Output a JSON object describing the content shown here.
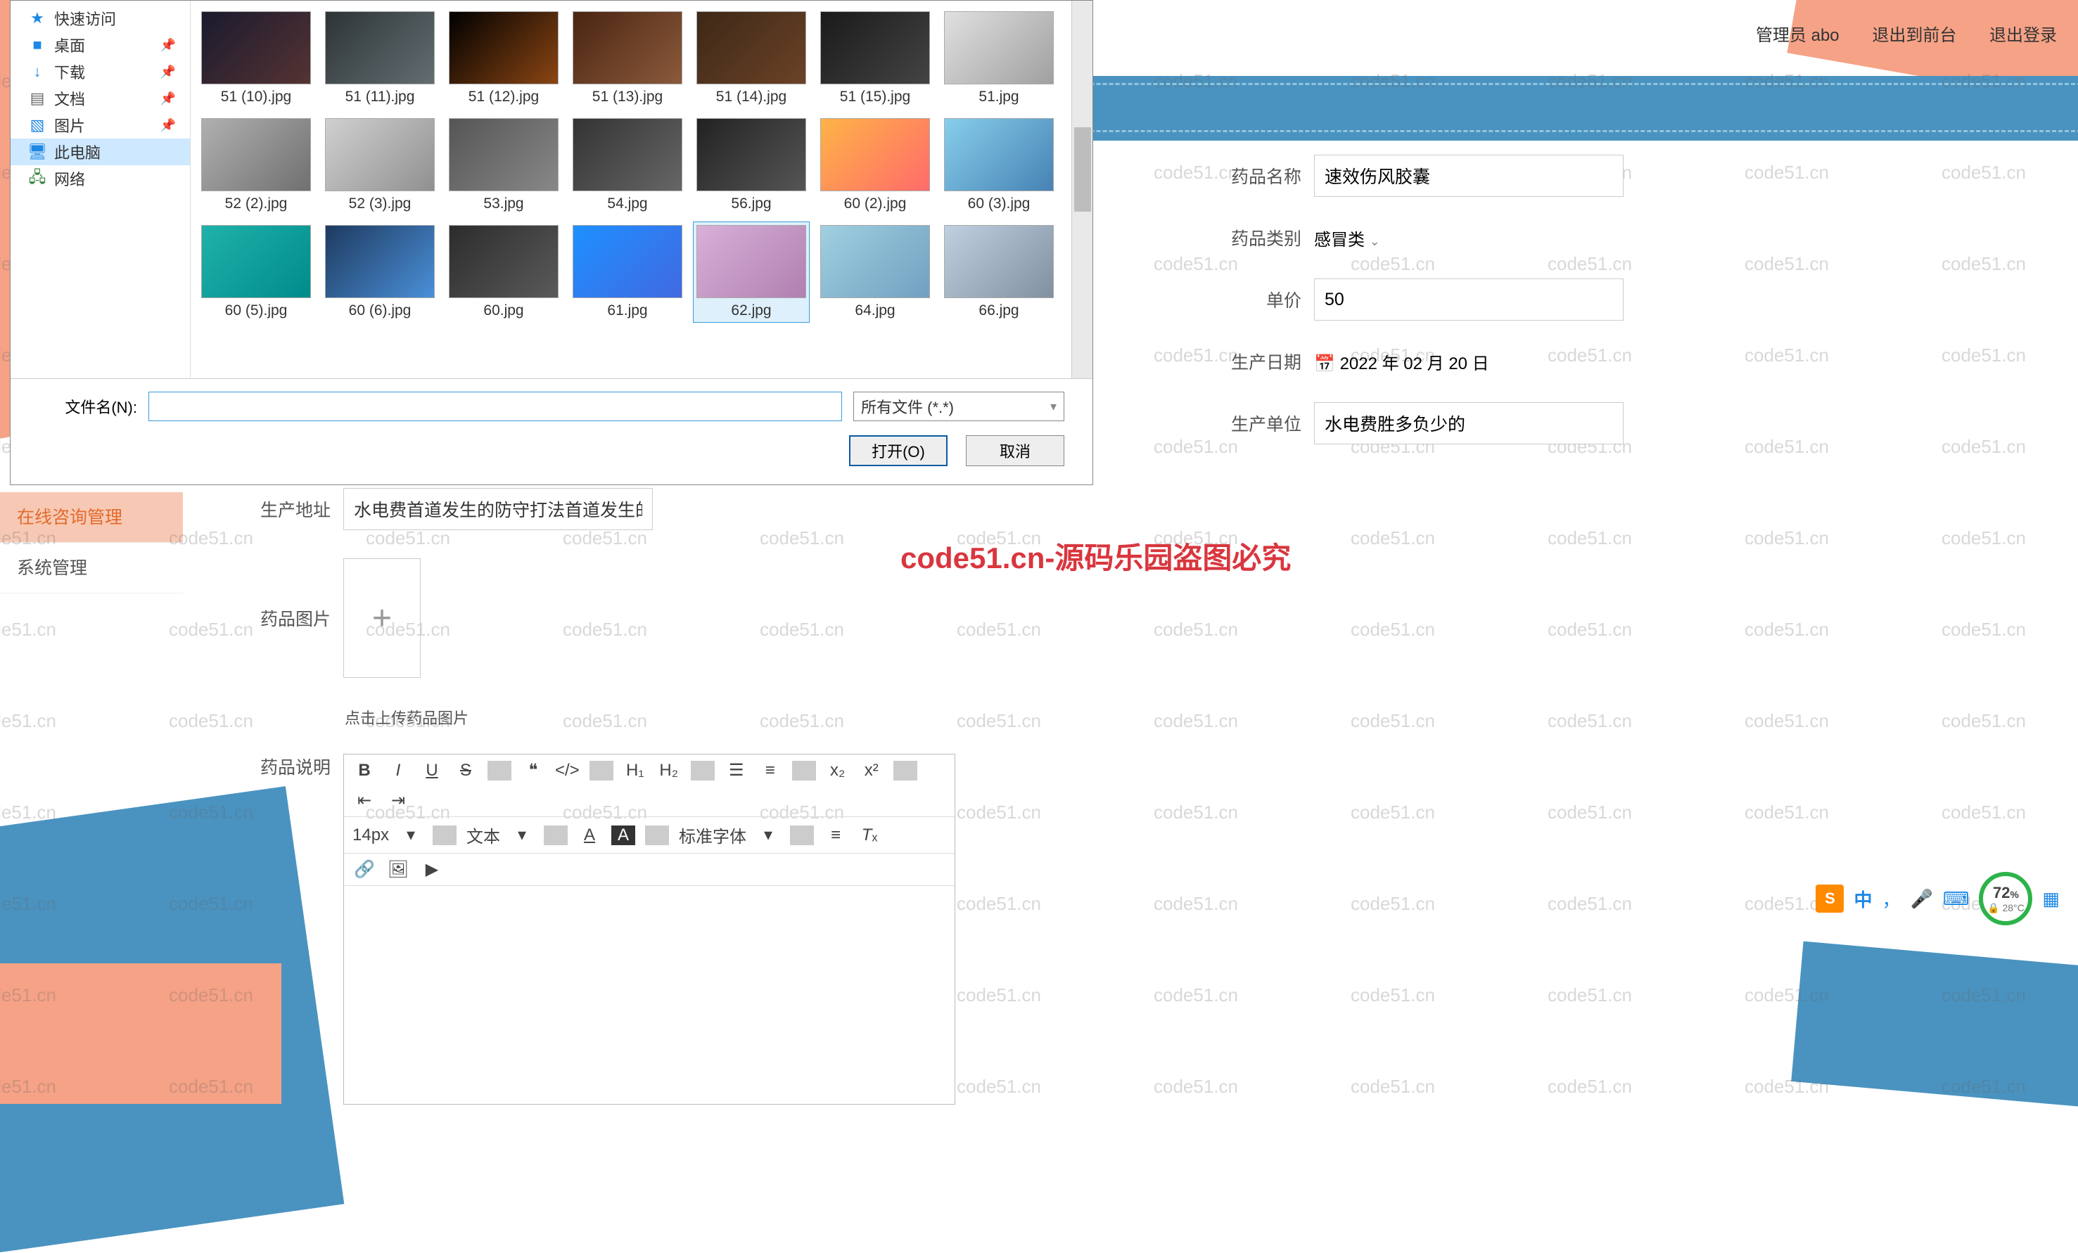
{
  "header": {
    "admin_label": "管理员 abo",
    "exit_front": "退出到前台",
    "logout": "退出登录"
  },
  "watermark": {
    "text": "code51.cn",
    "main": "code51.cn-源码乐园盗图必究"
  },
  "left_menu": {
    "items": [
      {
        "label": "在线咨询管理",
        "active": true
      },
      {
        "label": "系统管理",
        "active": false
      }
    ]
  },
  "form": {
    "address_label": "生产地址",
    "address_value": "水电费首道发生的防守打法首道发生的",
    "image_label": "药品图片",
    "upload_hint": "点击上传药品图片",
    "desc_label": "药品说明",
    "name_label": "药品名称",
    "name_value": "速效伤风胶囊",
    "category_label": "药品类别",
    "category_value": "感冒类",
    "price_label": "单价",
    "price_value": "50",
    "date_label": "生产日期",
    "date_value": "2022 年 02 月 20 日",
    "unit_label": "生产单位",
    "unit_value": "水电费胜多负少的"
  },
  "editor": {
    "font_size": "14px",
    "font_style_label": "文本",
    "font_family_label": "标准字体"
  },
  "file_dialog": {
    "nav": [
      {
        "icon": "star-icon",
        "label": "快速访问",
        "color": "#1e88e5"
      },
      {
        "icon": "desktop-icon",
        "label": "桌面",
        "color": "#1e88e5",
        "pin": true
      },
      {
        "icon": "download-icon",
        "label": "下载",
        "color": "#1e88e5",
        "pin": true
      },
      {
        "icon": "document-icon",
        "label": "文档",
        "color": "#666",
        "pin": true
      },
      {
        "icon": "picture-icon",
        "label": "图片",
        "color": "#1e88e5",
        "pin": true
      },
      {
        "icon": "pc-icon",
        "label": "此电脑",
        "color": "#1e88e5",
        "selected": true
      },
      {
        "icon": "network-icon",
        "label": "网络",
        "color": "#2e7d32"
      }
    ],
    "thumbs": [
      {
        "fn": "51 (10).jpg"
      },
      {
        "fn": "51 (11).jpg"
      },
      {
        "fn": "51 (12).jpg"
      },
      {
        "fn": "51 (13).jpg"
      },
      {
        "fn": "51 (14).jpg"
      },
      {
        "fn": "51 (15).jpg"
      },
      {
        "fn": "51.jpg"
      },
      {
        "fn": "52 (2).jpg"
      },
      {
        "fn": "52 (3).jpg"
      },
      {
        "fn": "53.jpg"
      },
      {
        "fn": "54.jpg"
      },
      {
        "fn": "56.jpg"
      },
      {
        "fn": "60 (2).jpg"
      },
      {
        "fn": "60 (3).jpg"
      },
      {
        "fn": "60 (5).jpg"
      },
      {
        "fn": "60 (6).jpg"
      },
      {
        "fn": "60.jpg"
      },
      {
        "fn": "61.jpg"
      },
      {
        "fn": "62.jpg",
        "selected": true
      },
      {
        "fn": "64.jpg"
      },
      {
        "fn": "66.jpg"
      }
    ],
    "filename_label": "文件名(N):",
    "filter_value": "所有文件 (*.*)",
    "open_label": "打开(O)",
    "cancel_label": "取消"
  },
  "tray": {
    "percent": "72",
    "percent_suffix": "%",
    "temp": "28°C",
    "sogou": "S",
    "ime": "中"
  }
}
